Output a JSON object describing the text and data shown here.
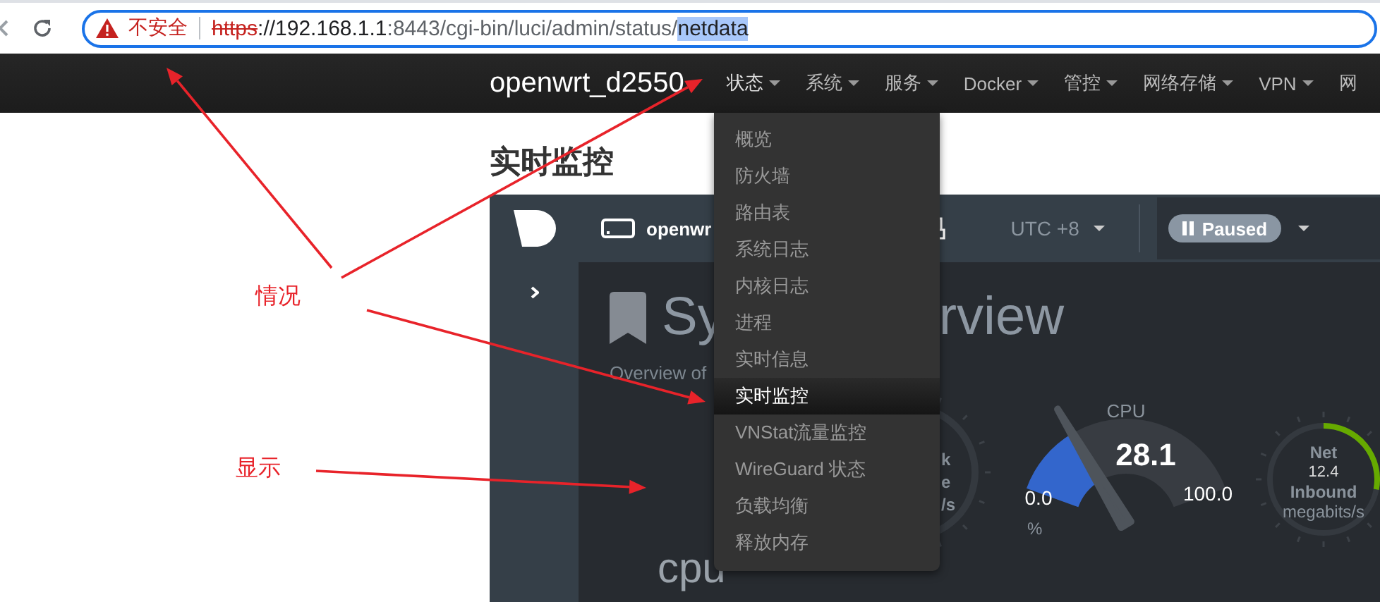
{
  "browser": {
    "security_label": "不安全",
    "url": {
      "scheme": "https",
      "host": "://192.168.1.1",
      "path": ":8443/cgi-bin/luci/admin/status/",
      "selected_text": "netdata"
    }
  },
  "navbar": {
    "brand": "openwrt_d2550",
    "menu": [
      {
        "label": "状态",
        "expanded": true,
        "has_caret": true
      },
      {
        "label": "系统",
        "expanded": false,
        "has_caret": true
      },
      {
        "label": "服务",
        "expanded": false,
        "has_caret": true
      },
      {
        "label": "Docker",
        "expanded": false,
        "has_caret": true
      },
      {
        "label": "管控",
        "expanded": false,
        "has_caret": true
      },
      {
        "label": "网络存储",
        "expanded": false,
        "has_caret": true
      },
      {
        "label": "VPN",
        "expanded": false,
        "has_caret": true
      },
      {
        "label": "网",
        "expanded": false,
        "has_caret": false
      }
    ]
  },
  "status_menu": {
    "items": [
      {
        "label": "概览",
        "selected": false
      },
      {
        "label": "防火墙",
        "selected": false
      },
      {
        "label": "路由表",
        "selected": false
      },
      {
        "label": "系统日志",
        "selected": false
      },
      {
        "label": "内核日志",
        "selected": false
      },
      {
        "label": "进程",
        "selected": false
      },
      {
        "label": "实时信息",
        "selected": false
      },
      {
        "label": "实时监控",
        "selected": true
      },
      {
        "label": "VNStat流量监控",
        "selected": false
      },
      {
        "label": "WireGuard 状态",
        "selected": false
      },
      {
        "label": "负载均衡",
        "selected": false
      },
      {
        "label": "释放内存",
        "selected": false
      }
    ]
  },
  "page_title": "实时监控",
  "netdata": {
    "host": "openwr",
    "timezone": "UTC +8",
    "playback": {
      "label": "Paused",
      "paused": true
    },
    "heading_parts": [
      "Sy",
      "rview"
    ],
    "subtitle": "Overview of",
    "gauges": [
      {
        "kind": "partial",
        "labels": [
          "k",
          "e",
          "/s"
        ]
      },
      {
        "kind": "dial",
        "title": "CPU",
        "value": "28.1",
        "min": "0.0",
        "max": "100.0",
        "unit": "%"
      },
      {
        "kind": "ring",
        "title": "Net",
        "value": "12.4",
        "subtitle": "Inbound",
        "unit": "megabits/s"
      }
    ],
    "section_title": "cpu"
  },
  "annotations": [
    {
      "text": "情况"
    },
    {
      "text": "显示"
    }
  ]
}
